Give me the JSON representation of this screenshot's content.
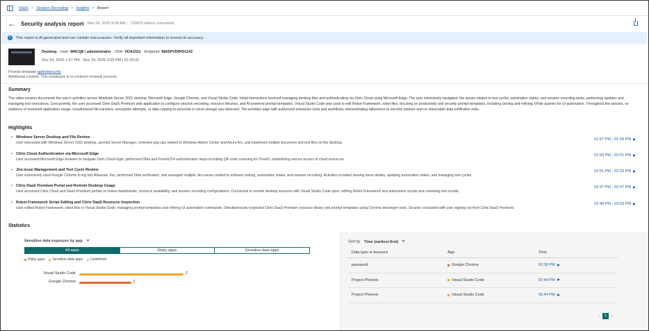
{
  "breadcrumb": [
    "DaaS",
    "Session Recording",
    "Insights"
  ],
  "breadcrumb_current": "Report",
  "header": {
    "title": "Security analysis report",
    "date": "Nov 24, 2025 9:28 AM",
    "tokens": "720075 tokens consumed"
  },
  "banner": "This report is AI-generated and can contain inaccuracies. Verify all important information to ensure its accuracy.",
  "session": {
    "machine": "Desktop",
    "user_label": "User:",
    "user": "M4CQ8 \\ administrator",
    "vda_label": "VDA:",
    "vda": "VDA2311",
    "endpoint_label": "Endpoint:",
    "endpoint": "MASPVDIPD1143",
    "time_range": "Nov 24, 2025 1:57 PM - Nov 24, 2025 3:03 PM",
    "duration": "01:05:32"
  },
  "prompt": {
    "template_label": "Prompt template:",
    "template": "aptestsecurity",
    "context_label": "Additional context:",
    "context": "This employee is in contract renewal process"
  },
  "summary_heading": "Summary",
  "summary_text": "The video session documents the user's activities across Windows Server 2022 desktop, Microsoft Edge, Google Chrome, and Visual Studio Code. Initial interactions involved managing desktop files and authenticating via Citrix Cloud using Microsoft Edge. The user extensively navigated Jira issues related to test cycles, automation states, and session recording tasks, performing updates and managing test executions. Concurrently, the user accessed Citrix DaaS Premium web application to configure session recording, resource libraries, and AI-powered prompt templates. Visual Studio Code was used to edit Robot Framework .robot files, focusing on productivity and security prompt templates, including cloning and refining XPath queries for UI automation. Throughout the session, no evidence of restricted application usage, unauthorized file transfers, encryption attempts, or data copying to personal or cloud storage was detected. The activities align with authorized enterprise tools and workflows, demonstrating adherence to security policies and no observable data exfiltration risks.",
  "highlights_heading": "Highlights",
  "highlights": [
    {
      "title": "Windows Server Desktop and File Review",
      "desc": "User interacted with Windows Server 2022 desktop, opened Server Manager, reviewed pop-ups related to Windows Admin Center and Azure Arc, and examined multiple document and text files on the desktop.",
      "time": "01:57 PM - 01:58 PM"
    },
    {
      "title": "Citrix Cloud Authentication via Microsoft Edge",
      "desc": "User accessed Microsoft Edge browser to navigate Citrix Cloud login, performed Okta and PureAUTH authentication steps including QR code scanning for PureID, establishing secure access to cloud resources.",
      "time": "01:58 PM - 02:01 PM"
    },
    {
      "title": "Jira Issue Management and Test Cycle Review",
      "desc": "User extensively used Google Chrome to log into Atlassian Jira, performed Okta verification, and managed multiple Jira issues related to software testing, automation states, and session recording. Activities included viewing issue details, updating automation states, and managing test cycles.",
      "time": "02:01 PM - 02:33 PM"
    },
    {
      "title": "Citrix DaaS Premium Portal and Remote Desktop Usage",
      "desc": "User accessed Citrix Cloud and DaaS Premium portals to review dashboards, resource availability, and session recording configurations. Connected to remote desktop sessions with Visual Studio Code open, editing Robot Framework test automation scripts and reviewing test results.",
      "time": "02:37 PM - 02:47 PM"
    },
    {
      "title": "Robot Framework Script Editing and Citrix DaaS Resource Inspection",
      "desc": "User edited Robot Framework .robot files in Visual Studio Code, managing prompt templates and refining UI automation commands. Simultaneously inspected Citrix DaaS Premium resource library and prompt templates using Chrome developer tools. Session concluded with user signing out from Citrix DaaS Premium.",
      "time": "02:48 PM - 03:03 PM"
    }
  ],
  "statistics_heading": "Statistics",
  "stats_left": {
    "dropdown": "Sensitive data exposure  by app",
    "tabs": [
      "All apps",
      "Risky apps",
      "Sensitive data apps"
    ],
    "legend": [
      "Risky apps",
      "Sensitive data apps",
      "Undefined"
    ],
    "colors": {
      "risky": "#e0692a",
      "sensitive": "#f0a91c",
      "undefined": "#b5b5b5",
      "accent": "#0f6a6a",
      "link": "#1d5fa0"
    }
  },
  "chart_data": {
    "type": "bar",
    "orientation": "horizontal",
    "categories": [
      "Visual Studio Code",
      "Google Chrome"
    ],
    "values": [
      2,
      1
    ],
    "colors": [
      "#f0a91c",
      "#e0692a"
    ]
  },
  "stats_right": {
    "sort_label": "Sort by",
    "sort_value": "Time (earliest first)",
    "columns": [
      "Data type or keyword",
      "App",
      "Time"
    ],
    "rows": [
      {
        "keyword": "password",
        "app": "Google Chrome",
        "app_color": "#e0692a",
        "time": "02:38 PM"
      },
      {
        "keyword": "Project Phoenix",
        "app": "Visual Studio Code",
        "app_color": "#f0a91c",
        "time": "02:44 PM"
      },
      {
        "keyword": "Project Phoenix",
        "app": "Visual Studio Code",
        "app_color": "#f0a91c",
        "time": "02:44 PM"
      }
    ],
    "page": "1"
  }
}
